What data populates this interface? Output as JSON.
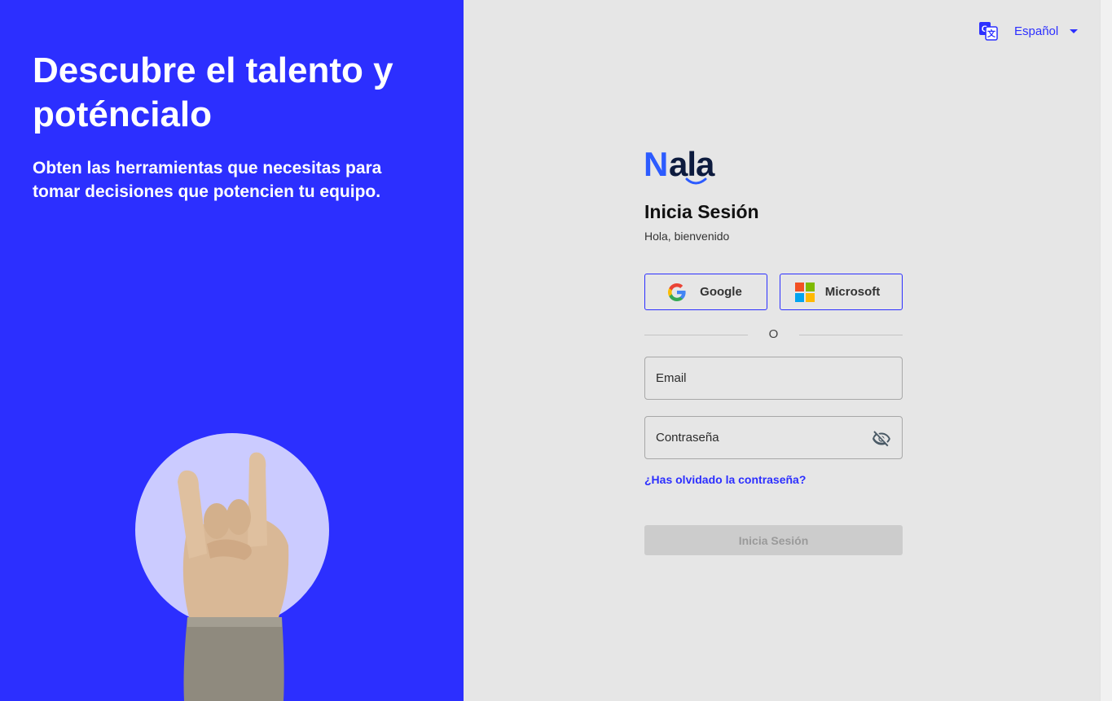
{
  "hero": {
    "title": "Descubre el talento y poténcialo",
    "subtitle": "Obten las herramientas que necesitas para tomar decisiones que potencien tu equipo."
  },
  "language": {
    "label": "Español",
    "icon": "translate-icon"
  },
  "logo": {
    "text": "Nala"
  },
  "login": {
    "title": "Inicia Sesión",
    "subtitle": "Hola, bienvenido",
    "google_label": "Google",
    "microsoft_label": "Microsoft",
    "divider_text": "O",
    "email_placeholder": "Email",
    "password_placeholder": "Contraseña",
    "forgot_label": "¿Has olvidado la contraseña?",
    "submit_label": "Inicia Sesión"
  },
  "colors": {
    "brand_blue": "#2c2fff",
    "panel_gray": "#e6e6e6",
    "disabled_button": "#cccccc",
    "logo_dark": "#0d1b3e",
    "logo_blue": "#2c5bff"
  }
}
